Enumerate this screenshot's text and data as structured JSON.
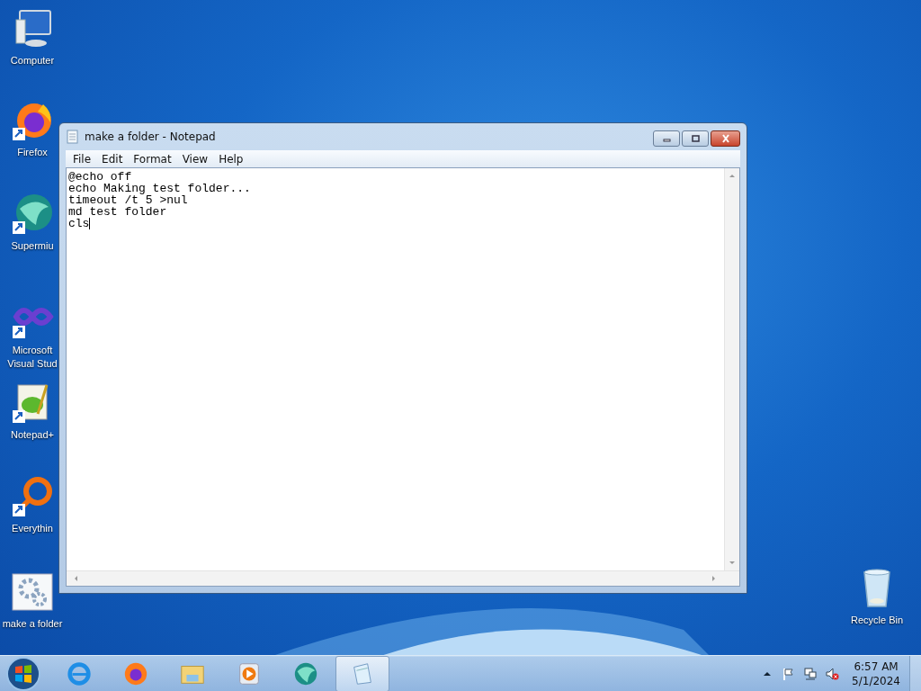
{
  "desktop_icons": [
    {
      "kind": "computer",
      "label": "Computer"
    },
    {
      "kind": "firefox",
      "label": "Firefox"
    },
    {
      "kind": "supermium",
      "label": "Supermiu"
    },
    {
      "kind": "vs",
      "label": "Microsoft Visual Stud"
    },
    {
      "kind": "notepadpp",
      "label": "Notepad+"
    },
    {
      "kind": "everything",
      "label": "Everythin"
    },
    {
      "kind": "batch",
      "label": "make a folder"
    }
  ],
  "recycle_bin": {
    "label": "Recycle Bin"
  },
  "window": {
    "title": "make a folder - Notepad",
    "menu": [
      "File",
      "Edit",
      "Format",
      "View",
      "Help"
    ],
    "lines": [
      "@echo off",
      "echo Making test folder...",
      "timeout /t 5 >nul",
      "md test folder",
      "cls"
    ]
  },
  "taskbar": {
    "items": [
      {
        "kind": "ie",
        "selected": false
      },
      {
        "kind": "firefox",
        "selected": false
      },
      {
        "kind": "explorer",
        "selected": false
      },
      {
        "kind": "media",
        "selected": false
      },
      {
        "kind": "supermium",
        "selected": false
      },
      {
        "kind": "notepad",
        "selected": true
      }
    ],
    "time": "6:57 AM",
    "date": "5/1/2024"
  }
}
